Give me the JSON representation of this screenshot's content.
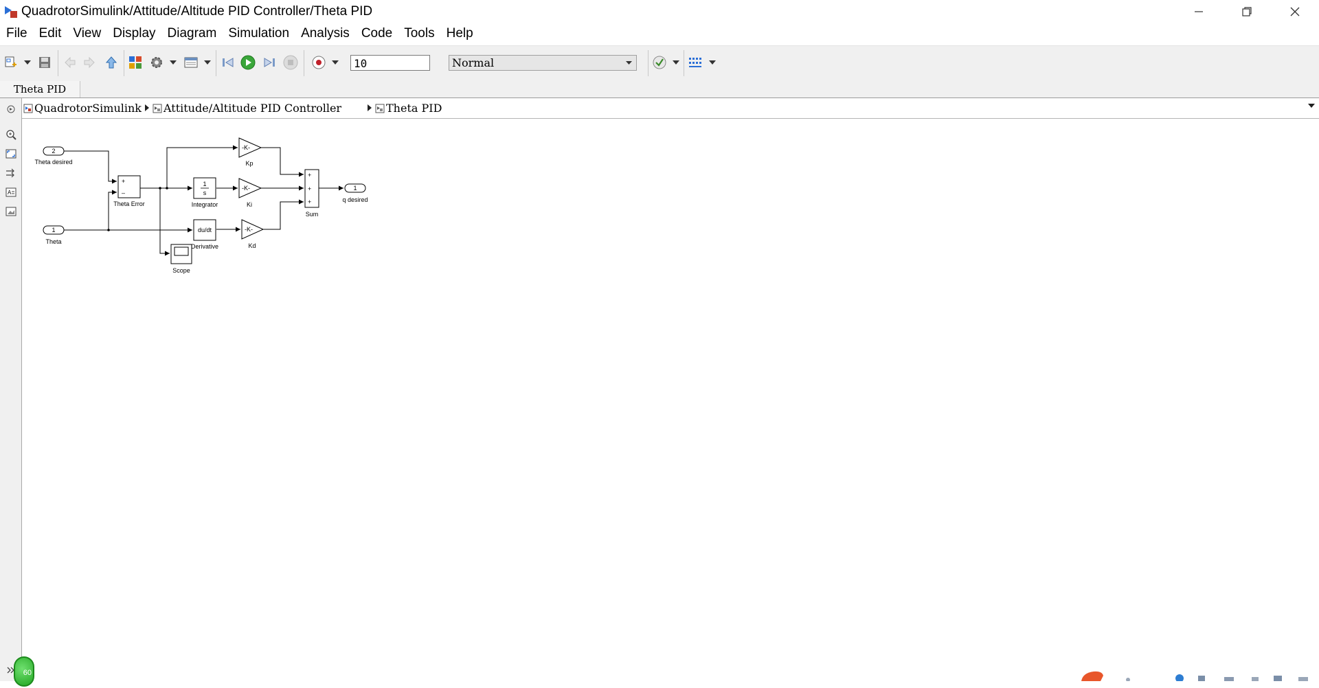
{
  "window": {
    "title": "QuadrotorSimulink/Attitude/Altitude PID Controller/Theta PID"
  },
  "menu": [
    "File",
    "Edit",
    "View",
    "Display",
    "Diagram",
    "Simulation",
    "Analysis",
    "Code",
    "Tools",
    "Help"
  ],
  "toolbar": {
    "stop_time": "10",
    "sim_mode": "Normal"
  },
  "tab": {
    "label": "Theta PID"
  },
  "breadcrumb": [
    "QuadrotorSimulink",
    "Attitude/Altitude PID Controller",
    "Theta PID"
  ],
  "diagram": {
    "blocks": {
      "theta_desired_port": "2",
      "theta_desired_label": "Theta desired",
      "theta_port": "1",
      "theta_label": "Theta",
      "theta_error_label": "Theta Error",
      "sum_plus": "+",
      "sum_minus": "–",
      "integrator_num": "1",
      "integrator_den": "s",
      "integrator_label": "Integrator",
      "derivative_text": "du/dt",
      "derivative_label": "Derivative",
      "scope_label": "Scope",
      "kp_text": "-K-",
      "kp_label": "Kp",
      "ki_text": "-K-",
      "ki_label": "Ki",
      "kd_text": "-K-",
      "kd_label": "Kd",
      "sum_label": "Sum",
      "out_port": "1",
      "out_label": "q desired"
    }
  },
  "badge": {
    "text": "60"
  }
}
